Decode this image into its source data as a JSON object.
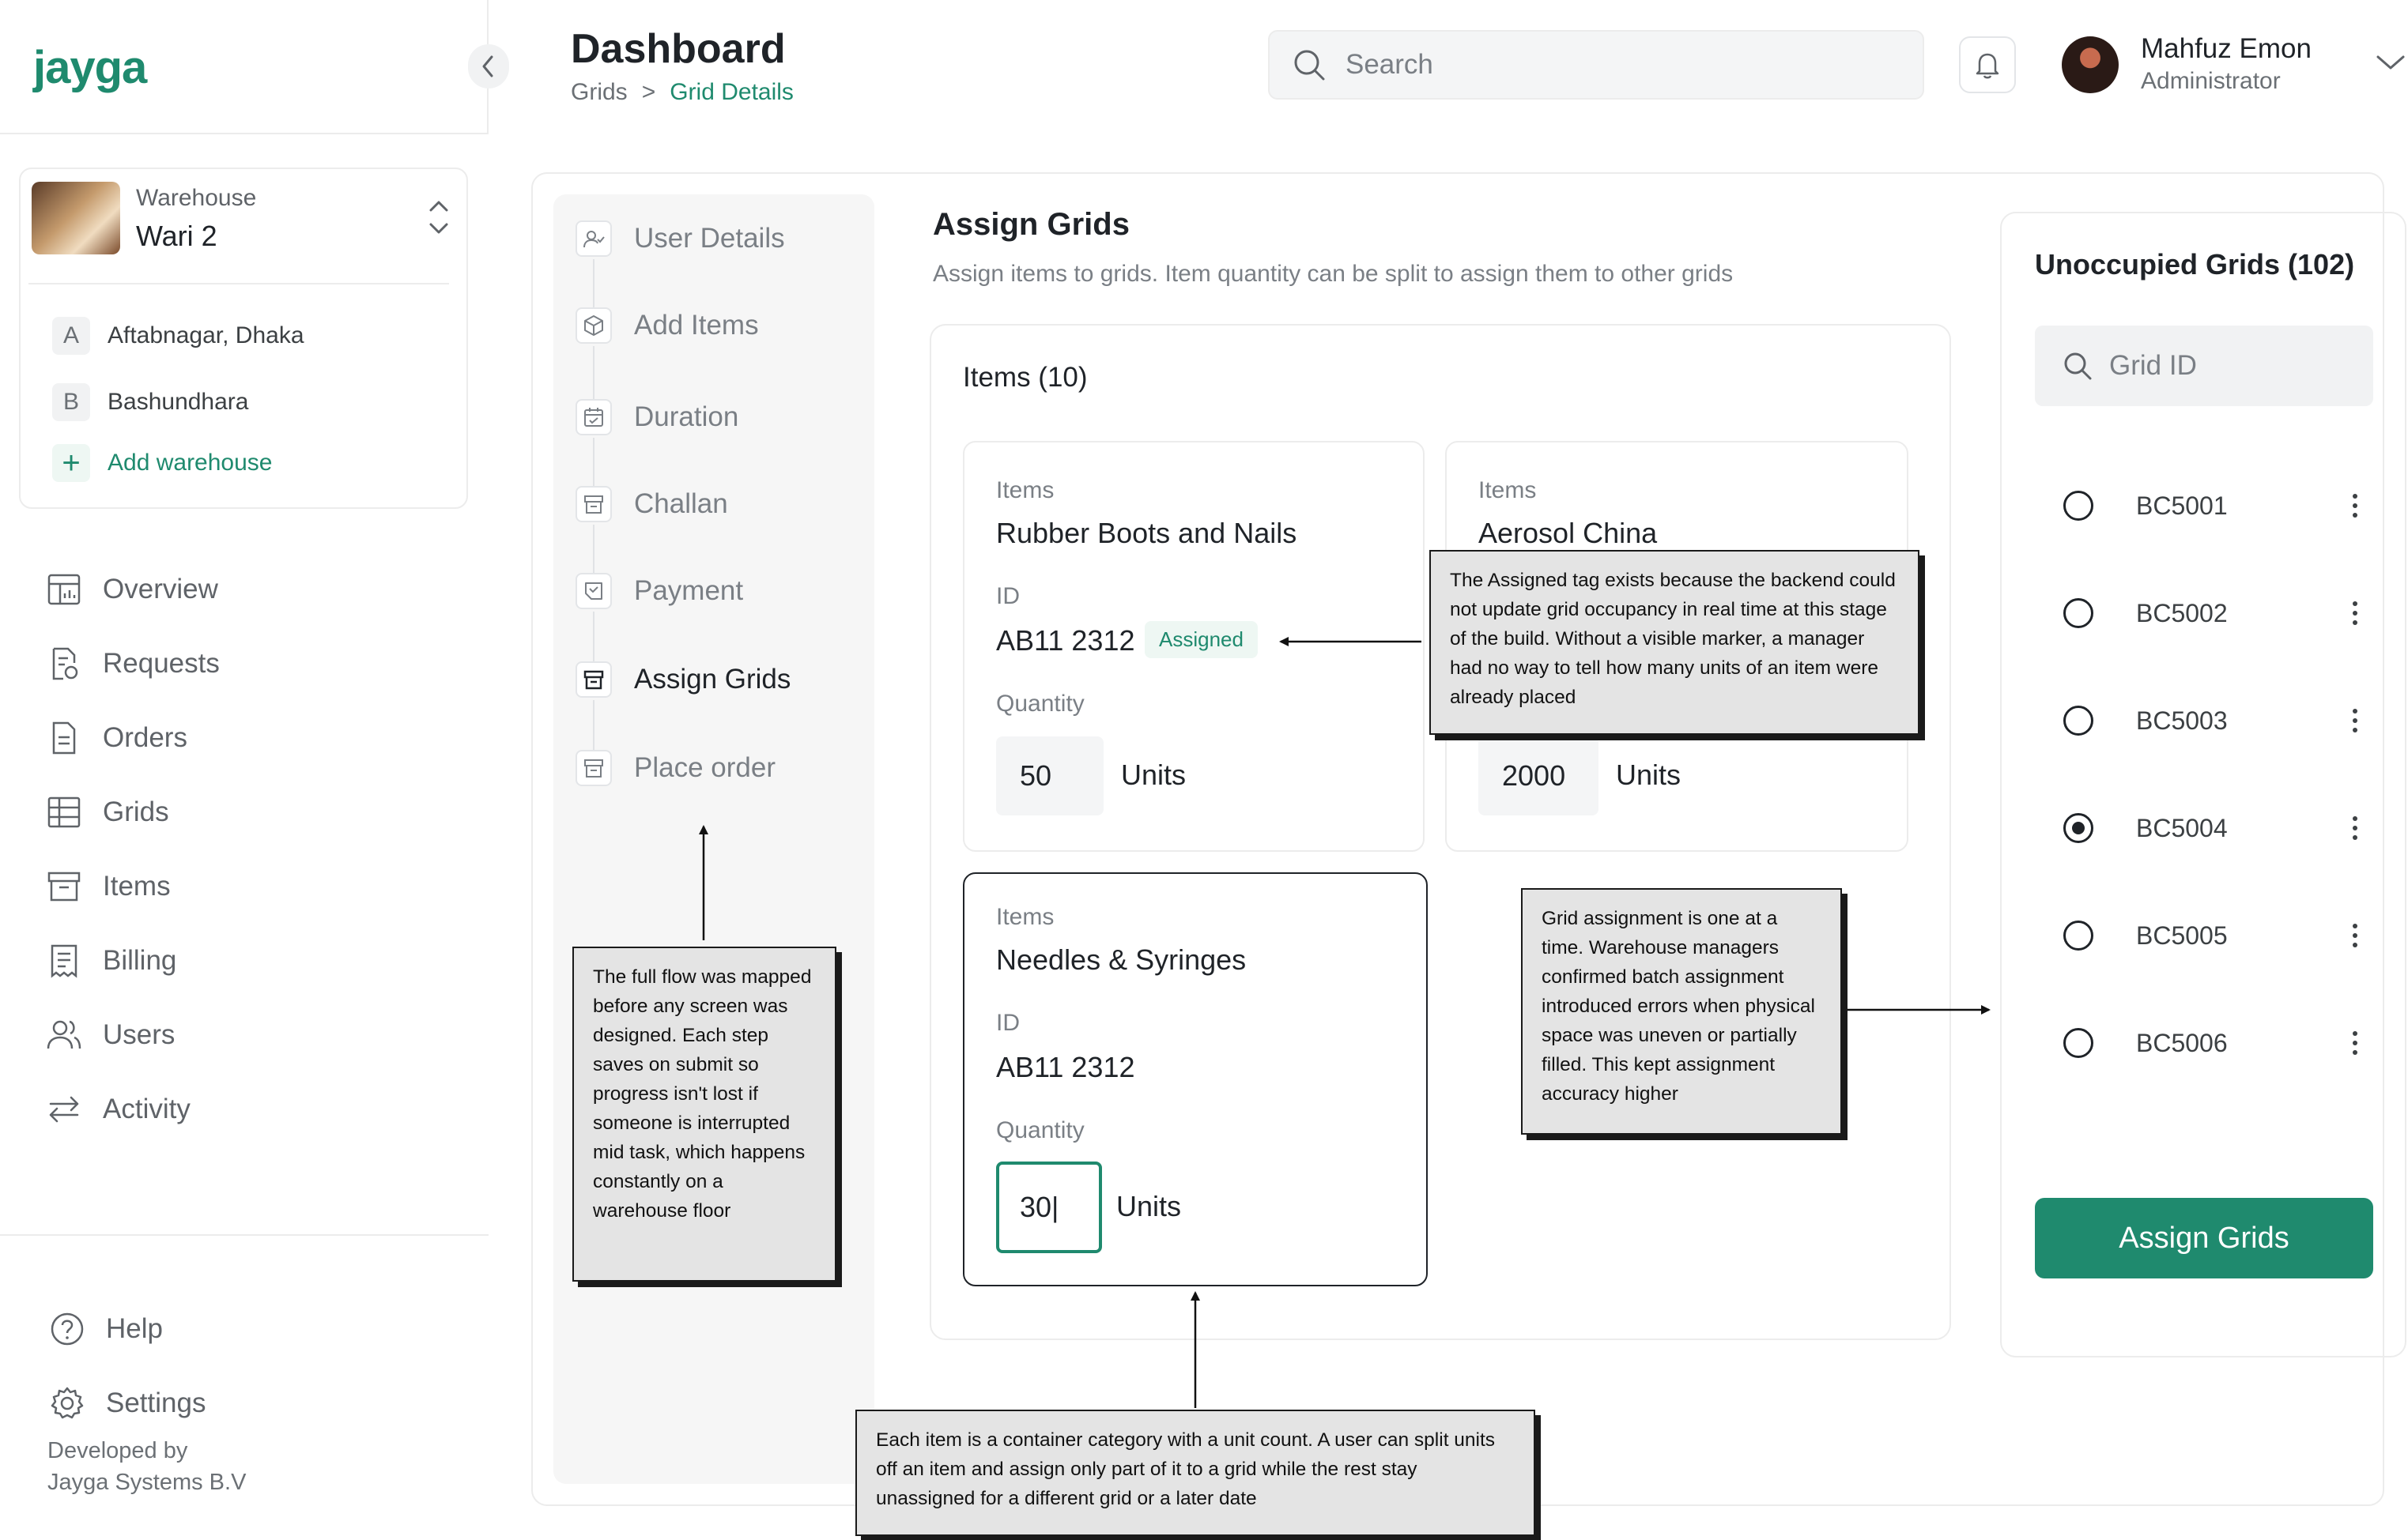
{
  "app": {
    "logo": "jayga"
  },
  "header": {
    "title": "Dashboard",
    "breadcrumb": [
      "Grids",
      "Grid Details"
    ],
    "breadcrumb_separator": ">",
    "search_placeholder": "Search",
    "user_name": "Mahfuz Emon",
    "user_role": "Administrator"
  },
  "warehouse": {
    "label": "Warehouse",
    "selected": "Wari 2",
    "options": [
      {
        "letter": "A",
        "name": "Aftabnagar, Dhaka"
      },
      {
        "letter": "B",
        "name": "Bashundhara"
      }
    ],
    "add_label": "Add warehouse"
  },
  "nav": {
    "items": [
      {
        "label": "Overview",
        "icon": "overview-icon"
      },
      {
        "label": "Requests",
        "icon": "requests-icon"
      },
      {
        "label": "Orders",
        "icon": "orders-icon"
      },
      {
        "label": "Grids",
        "icon": "grids-icon"
      },
      {
        "label": "Items",
        "icon": "items-icon"
      },
      {
        "label": "Billing",
        "icon": "billing-icon"
      },
      {
        "label": "Users",
        "icon": "users-icon"
      },
      {
        "label": "Activity",
        "icon": "activity-icon"
      }
    ],
    "help": "Help",
    "settings": "Settings",
    "developed_by": "Developed by",
    "developer": "Jayga Systems B.V"
  },
  "steps": {
    "items": [
      {
        "label": "User Details",
        "icon": "user-icon"
      },
      {
        "label": "Add Items",
        "icon": "box-icon"
      },
      {
        "label": "Duration",
        "icon": "calendar-icon"
      },
      {
        "label": "Challan",
        "icon": "store-icon"
      },
      {
        "label": "Payment",
        "icon": "payment-icon"
      },
      {
        "label": "Assign Grids",
        "icon": "store-icon"
      },
      {
        "label": "Place order",
        "icon": "store-icon"
      }
    ],
    "active_index": 5
  },
  "assign": {
    "title": "Assign Grids",
    "subtitle": "Assign items to grids. Item quantity can be split to assign them to other grids",
    "items_title": "Items (10)",
    "items_label": "Items",
    "id_label": "ID",
    "quantity_label": "Quantity",
    "units_label": "Units",
    "cards": [
      {
        "name": "Rubber Boots and Nails",
        "id": "AB11 2312",
        "badge": "Assigned",
        "quantity": "50"
      },
      {
        "name": "Aerosol China",
        "quantity": "2000"
      },
      {
        "name": "Needles & Syringes",
        "id": "AB11 2312",
        "quantity": "30|"
      }
    ]
  },
  "grids": {
    "title": "Unoccupied Grids (102)",
    "search_placeholder": "Grid ID",
    "rows": [
      {
        "id": "BC5001",
        "selected": false
      },
      {
        "id": "BC5002",
        "selected": false
      },
      {
        "id": "BC5003",
        "selected": false
      },
      {
        "id": "BC5004",
        "selected": true
      },
      {
        "id": "BC5005",
        "selected": false
      },
      {
        "id": "BC5006",
        "selected": false
      }
    ],
    "button": "Assign Grids"
  },
  "annotations": {
    "assigned_tag": "The Assigned tag exists because the backend could not update grid occupancy in real time at this stage of the build. Without a visible marker, a manager had no way to tell how many units of an item were already placed",
    "flow": "The full flow was mapped before any screen was designed. Each step saves on submit so progress isn't lost if someone is interrupted mid task, which happens constantly on a warehouse floor",
    "grid_assignment": "Grid assignment is one at a time. Warehouse managers confirmed batch assignment introduced errors when physical space was uneven or partially filled. This kept assignment accuracy higher",
    "item_split": "Each item is a container category with a unit count. A user can split units off an item and assign only part of it to a grid while the rest stay unassigned for a different grid or a later date"
  },
  "colors": {
    "brand": "#1f8a6e",
    "brand_dot": "#f2a33a",
    "text": "#1f2328",
    "muted": "#7a7f85",
    "annotation_bg": "#e4e4e4"
  }
}
